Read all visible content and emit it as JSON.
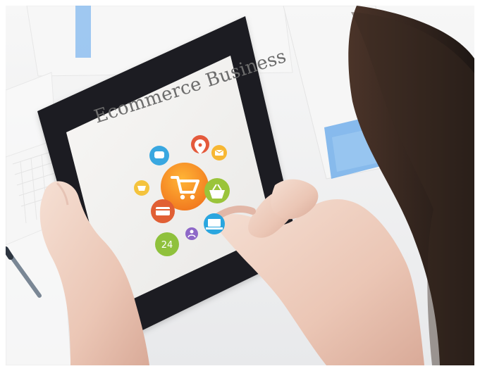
{
  "scene": {
    "title_text": "Ecommerce Business",
    "colors": {
      "photo_bg": "#f3f4f5",
      "tablet_frame": "#1f1f22",
      "screen": "#f2f1ee",
      "skin": "#efd0c1",
      "hair": "#2b211b",
      "blue_paper": "#5f9ee5",
      "orange": "#f28d1c",
      "red": "#e75335",
      "green": "#9dc63f",
      "blue_icon": "#2ca2df",
      "purple": "#8d68c7",
      "yellow": "#f5b915"
    }
  }
}
